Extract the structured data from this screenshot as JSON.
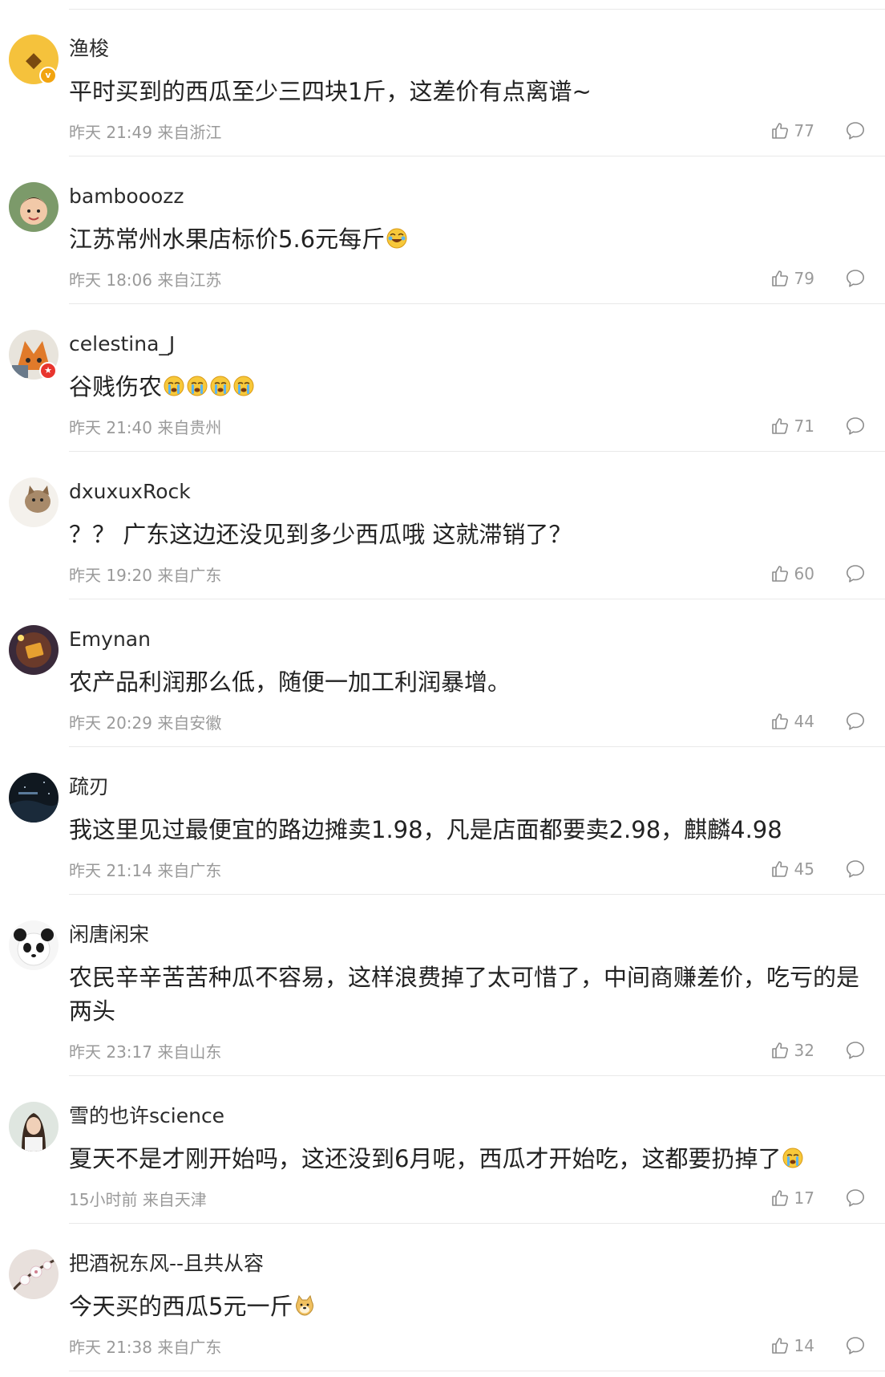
{
  "comments": [
    {
      "name": "渔梭",
      "content": "平时买到的西瓜至少三四块1斤，这差价有点离谱~",
      "time": "昨天 21:49",
      "location": "来自浙江",
      "likes": "77"
    },
    {
      "name": "bambooozz",
      "content": "江苏常州水果店标价5.6元每斤",
      "time": "昨天 18:06",
      "location": "来自江苏",
      "likes": "79"
    },
    {
      "name": "celestina_J",
      "content": "谷贱伤农",
      "time": "昨天 21:40",
      "location": "来自贵州",
      "likes": "71"
    },
    {
      "name": "dxuxuxRock",
      "content": "？？ 广东这边还没见到多少西瓜哦 这就滞销了？",
      "time": "昨天 19:20",
      "location": "来自广东",
      "likes": "60"
    },
    {
      "name": "Emynan",
      "content": "农产品利润那么低，随便一加工利润暴增。",
      "time": "昨天 20:29",
      "location": "来自安徽",
      "likes": "44"
    },
    {
      "name": "疏刃",
      "content": "我这里见过最便宜的路边摊卖1.98，凡是店面都要卖2.98，麒麟4.98",
      "time": "昨天 21:14",
      "location": "来自广东",
      "likes": "45"
    },
    {
      "name": "闲唐闲宋",
      "content": "农民辛辛苦苦种瓜不容易，这样浪费掉了太可惜了，中间商赚差价，吃亏的是两头",
      "time": "昨天 23:17",
      "location": "来自山东",
      "likes": "32"
    },
    {
      "name": "雪的也许science",
      "content": "夏天不是才刚开始吗，这还没到6月呢，西瓜才开始吃，这都要扔掉了",
      "time": "15小时前",
      "location": "来自天津",
      "likes": "17"
    },
    {
      "name": "把酒祝东风--且共从容",
      "content": "今天买的西瓜5元一斤",
      "time": "昨天 21:38",
      "location": "来自广东",
      "likes": "14"
    }
  ],
  "icons": {
    "like": "thumbs-up-icon",
    "reply": "comment-bubble-icon",
    "crying": "crying-emoji-icon",
    "laughing": "laughing-emoji-icon",
    "doge": "doge-emoji-icon"
  },
  "colors": {
    "meta": "#9a9a9a",
    "divider": "#e9e9e9",
    "verified": "#f2a40f",
    "badge_red": "#e8352e"
  }
}
